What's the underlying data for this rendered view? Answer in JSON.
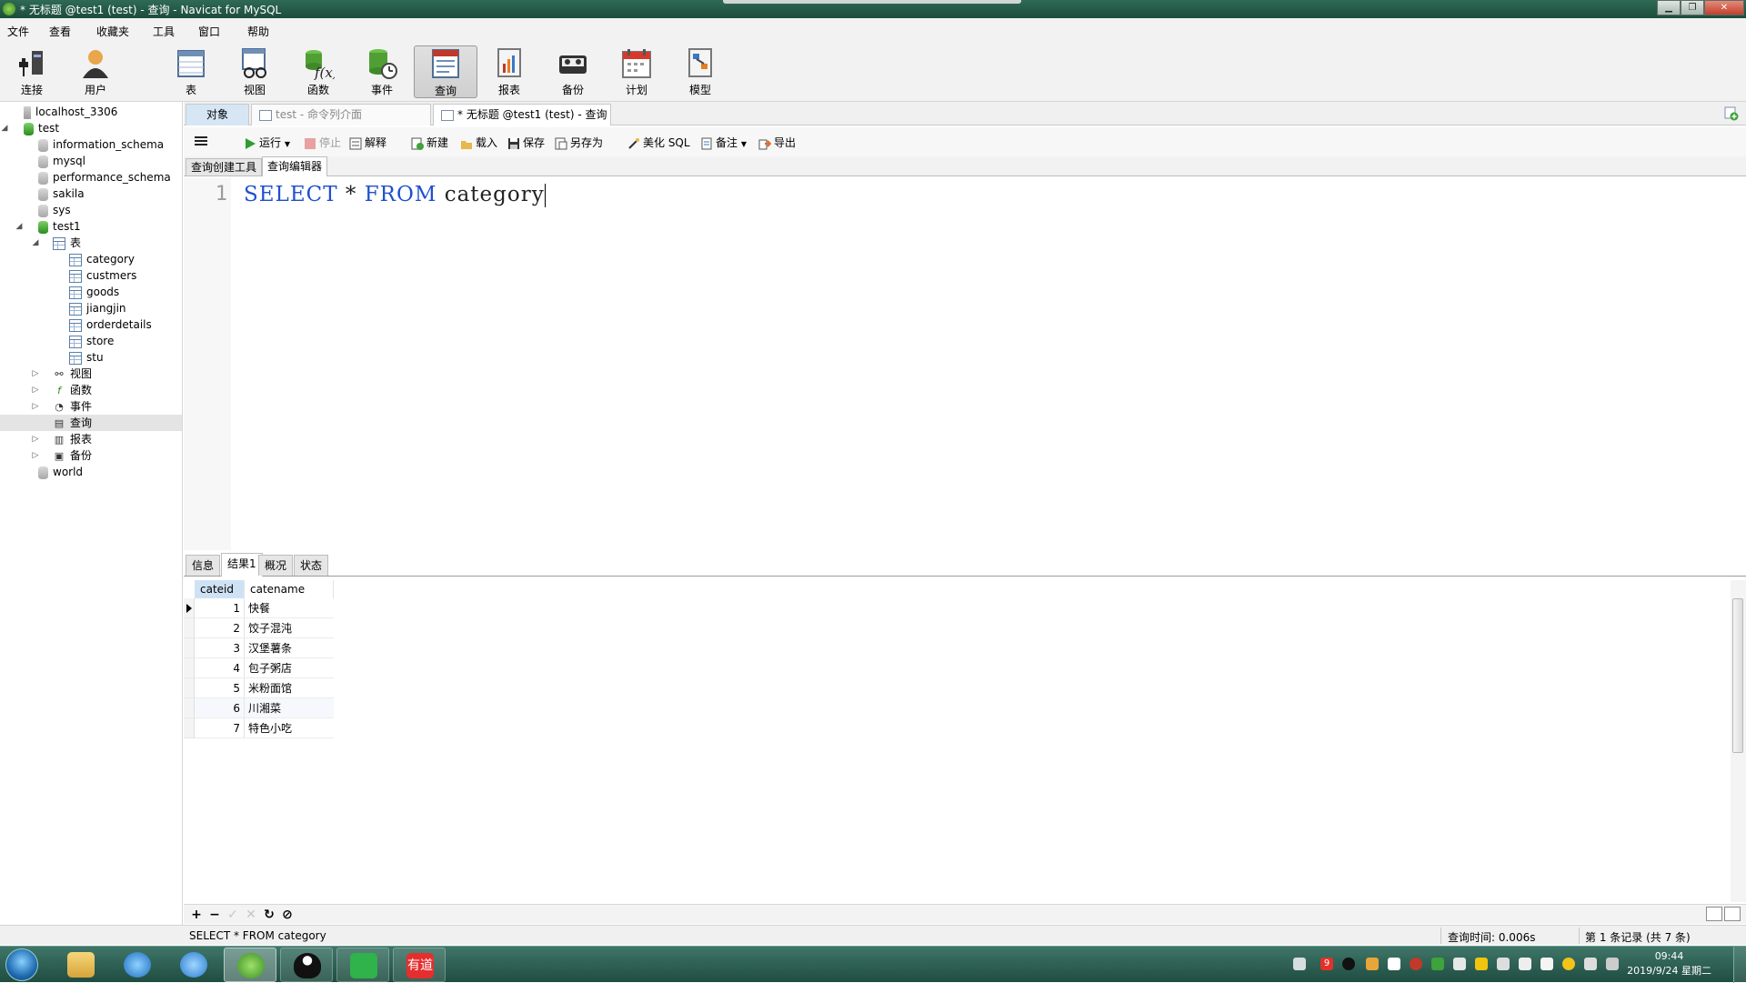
{
  "window": {
    "title": "* 无标题 @test1 (test) - 查询 - Navicat for MySQL"
  },
  "menu": [
    "文件",
    "查看",
    "收藏夹",
    "工具",
    "窗口",
    "帮助"
  ],
  "toolbar": {
    "buttons": [
      {
        "label": "连接",
        "icon": "connection-icon"
      },
      {
        "label": "用户",
        "icon": "user-icon"
      },
      {
        "label": "表",
        "icon": "table-icon"
      },
      {
        "label": "视图",
        "icon": "view-icon"
      },
      {
        "label": "函数",
        "icon": "function-icon"
      },
      {
        "label": "事件",
        "icon": "event-icon"
      },
      {
        "label": "查询",
        "icon": "query-icon"
      },
      {
        "label": "报表",
        "icon": "report-icon"
      },
      {
        "label": "备份",
        "icon": "backup-icon"
      },
      {
        "label": "计划",
        "icon": "schedule-icon"
      },
      {
        "label": "模型",
        "icon": "model-icon"
      }
    ],
    "active": "查询"
  },
  "tree": {
    "items": [
      {
        "label": "localhost_3306",
        "level": 0,
        "type": "server"
      },
      {
        "label": "test",
        "level": 0,
        "type": "server-open",
        "expander": "◢"
      },
      {
        "label": "information_schema",
        "level": 1,
        "type": "db"
      },
      {
        "label": "mysql",
        "level": 1,
        "type": "db"
      },
      {
        "label": "performance_schema",
        "level": 1,
        "type": "db"
      },
      {
        "label": "sakila",
        "level": 1,
        "type": "db"
      },
      {
        "label": "sys",
        "level": 1,
        "type": "db"
      },
      {
        "label": "test1",
        "level": 1,
        "type": "db-open",
        "expander": "◢"
      },
      {
        "label": "表",
        "level": 2,
        "type": "folder-table",
        "expander": "◢"
      },
      {
        "label": "category",
        "level": 3,
        "type": "table"
      },
      {
        "label": "custmers",
        "level": 3,
        "type": "table"
      },
      {
        "label": "goods",
        "level": 3,
        "type": "table"
      },
      {
        "label": "jiangjin",
        "level": 3,
        "type": "table"
      },
      {
        "label": "orderdetails",
        "level": 3,
        "type": "table"
      },
      {
        "label": "store",
        "level": 3,
        "type": "table"
      },
      {
        "label": "stu",
        "level": 3,
        "type": "table"
      },
      {
        "label": "视图",
        "level": 2,
        "type": "folder-view",
        "expander": "▷"
      },
      {
        "label": "函数",
        "level": 2,
        "type": "folder-func",
        "expander": "▷"
      },
      {
        "label": "事件",
        "level": 2,
        "type": "folder-event",
        "expander": "▷"
      },
      {
        "label": "查询",
        "level": 2,
        "type": "folder-query",
        "selected": true
      },
      {
        "label": "报表",
        "level": 2,
        "type": "folder-report",
        "expander": "▷"
      },
      {
        "label": "备份",
        "level": 2,
        "type": "folder-backup",
        "expander": "▷"
      },
      {
        "label": "world",
        "level": 1,
        "type": "db"
      }
    ]
  },
  "tabs": {
    "objects": "对象",
    "cmd": "test - 命令列介面",
    "query": "* 无标题 @test1 (test) - 查询"
  },
  "query_toolbar": {
    "run": "运行",
    "stop": "停止",
    "explain": "解释",
    "new": "新建",
    "load": "载入",
    "save": "保存",
    "save_as": "另存为",
    "beautify": "美化 SQL",
    "comment": "备注",
    "export": "导出"
  },
  "editor_tabs": {
    "builder": "查询创建工具",
    "editor": "查询编辑器"
  },
  "editor": {
    "line_number": "1",
    "tokens": {
      "select": "SELECT",
      "star": "*",
      "from": "FROM",
      "table": "category"
    }
  },
  "result_tabs": [
    "信息",
    "结果1",
    "概况",
    "状态"
  ],
  "result": {
    "columns": [
      "cateid",
      "catename"
    ],
    "rows": [
      [
        "1",
        "快餐"
      ],
      [
        "2",
        "饺子混沌"
      ],
      [
        "3",
        "汉堡薯条"
      ],
      [
        "4",
        "包子粥店"
      ],
      [
        "5",
        "米粉面馆"
      ],
      [
        "6",
        "川湘菜"
      ],
      [
        "7",
        "特色小吃"
      ]
    ]
  },
  "grid_buttons": [
    "+",
    "−",
    "✓",
    "✕",
    "↻",
    "⊘"
  ],
  "status": {
    "sql": "SELECT * FROM category",
    "query_time": "查询时间: 0.006s",
    "records": "第 1 条记录 (共 7 条)"
  },
  "taskbar": {
    "time": "09:44",
    "date": "2019/9/24 星期二",
    "tray_badge": "9"
  }
}
